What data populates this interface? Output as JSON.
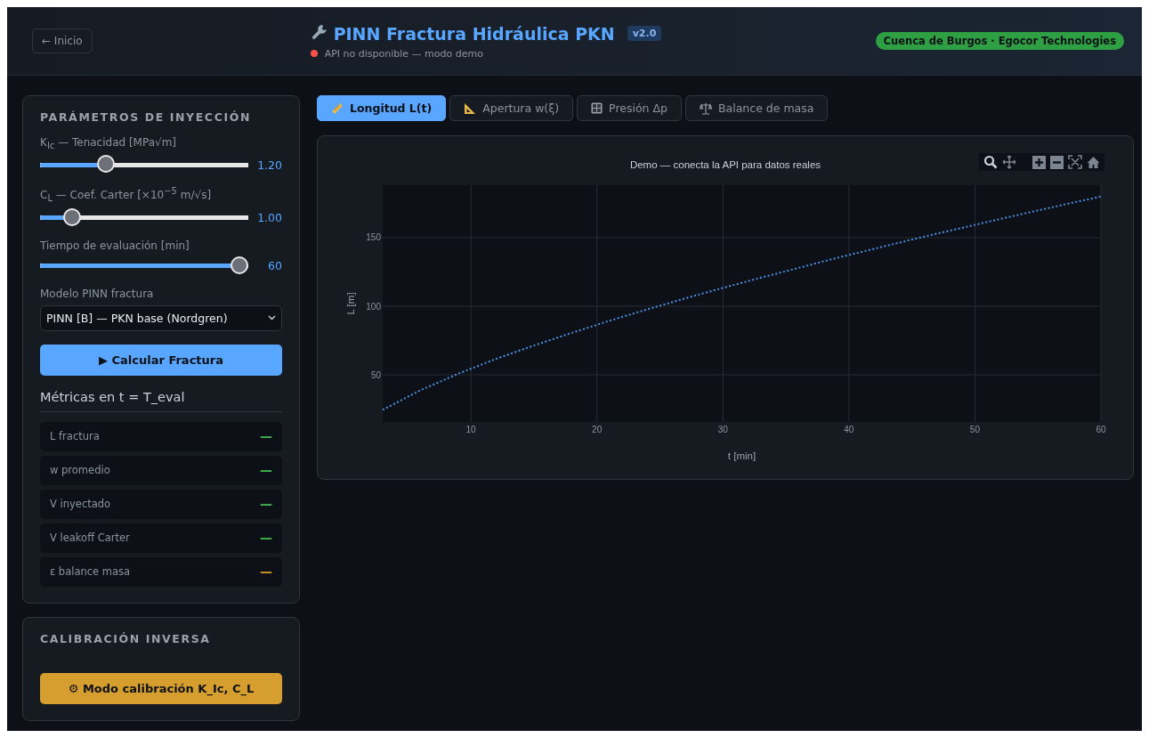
{
  "header": {
    "back_button": "← Inicio",
    "title": "PINN Fractura Hidráulica PKN",
    "version": "v2.0",
    "status": {
      "online": false,
      "text": "API no disponible — modo demo"
    },
    "badge": "Cuenca de Burgos · Egocor Technologies"
  },
  "params_panel": {
    "title": "PARÁMETROS DE INYECCIÓN",
    "sliders": [
      {
        "label": "K$_{Ic}$ — Tenacidad [MPa√m]",
        "level": 0.3,
        "reading": "1.20"
      },
      {
        "label": "C$_{L}$ — Coef. Carter [×10$^{−5}$ m/√s]",
        "level": 0.12,
        "reading": "1.00"
      },
      {
        "label": "Tiempo de evaluación [min]",
        "level": 1.0,
        "reading": "60"
      }
    ],
    "model_select": {
      "label": "Modelo PINN fractura",
      "value": "PINN [B] — PKN base (Nordgren)"
    },
    "calc_button": "▶ Calcular Fractura",
    "metrics_title": "Métricas en t = T_eval",
    "metrics": [
      {
        "label": "L fractura",
        "value": "—",
        "color": "#3fb950"
      },
      {
        "label": "w promedio",
        "value": "—",
        "color": "#3fb950"
      },
      {
        "label": "V inyectado",
        "value": "—",
        "color": "#3fb950"
      },
      {
        "label": "V leakoff Carter",
        "value": "—",
        "color": "#3fb950"
      },
      {
        "label": "ε balance masa",
        "value": "—",
        "color": "#d29922"
      }
    ]
  },
  "calibration_panel": {
    "title": "CALIBRACIÓN INVERSA",
    "button": "⚙ Modo calibración K_Ic, C_L"
  },
  "tabs": [
    {
      "label": "Longitud L(t)",
      "selected": true
    },
    {
      "label": "Apertura w(ξ)",
      "selected": false
    },
    {
      "label": "Presión Δp",
      "selected": false
    },
    {
      "label": "Balance de masa",
      "selected": false
    }
  ],
  "chart": {
    "chart_data": {
      "type": "line",
      "title": "Demo — conecta la API para datos reales",
      "xlabel": "t [min]",
      "ylabel": "L [m]",
      "x": [
        3,
        6,
        9,
        12,
        15,
        18,
        21,
        24,
        27,
        30,
        33,
        36,
        39,
        42,
        45,
        48,
        51,
        54,
        57,
        60
      ],
      "series": [
        {
          "color": "#4a90e2",
          "line_style": "dotted",
          "values": [
            24.4,
            38.8,
            50.8,
            61.6,
            71.4,
            80.6,
            89.4,
            97.7,
            105.7,
            113.4,
            120.8,
            128.0,
            135.1,
            141.9,
            148.6,
            155.1,
            161.5,
            167.8,
            174.0,
            180.0
          ]
        }
      ],
      "xlim": [
        3,
        60
      ],
      "ylim": [
        15.6,
        188.3
      ],
      "xticks": [
        10,
        20,
        30,
        40,
        50,
        60
      ],
      "yticks": [
        50,
        100,
        150
      ],
      "grid": true
    }
  }
}
